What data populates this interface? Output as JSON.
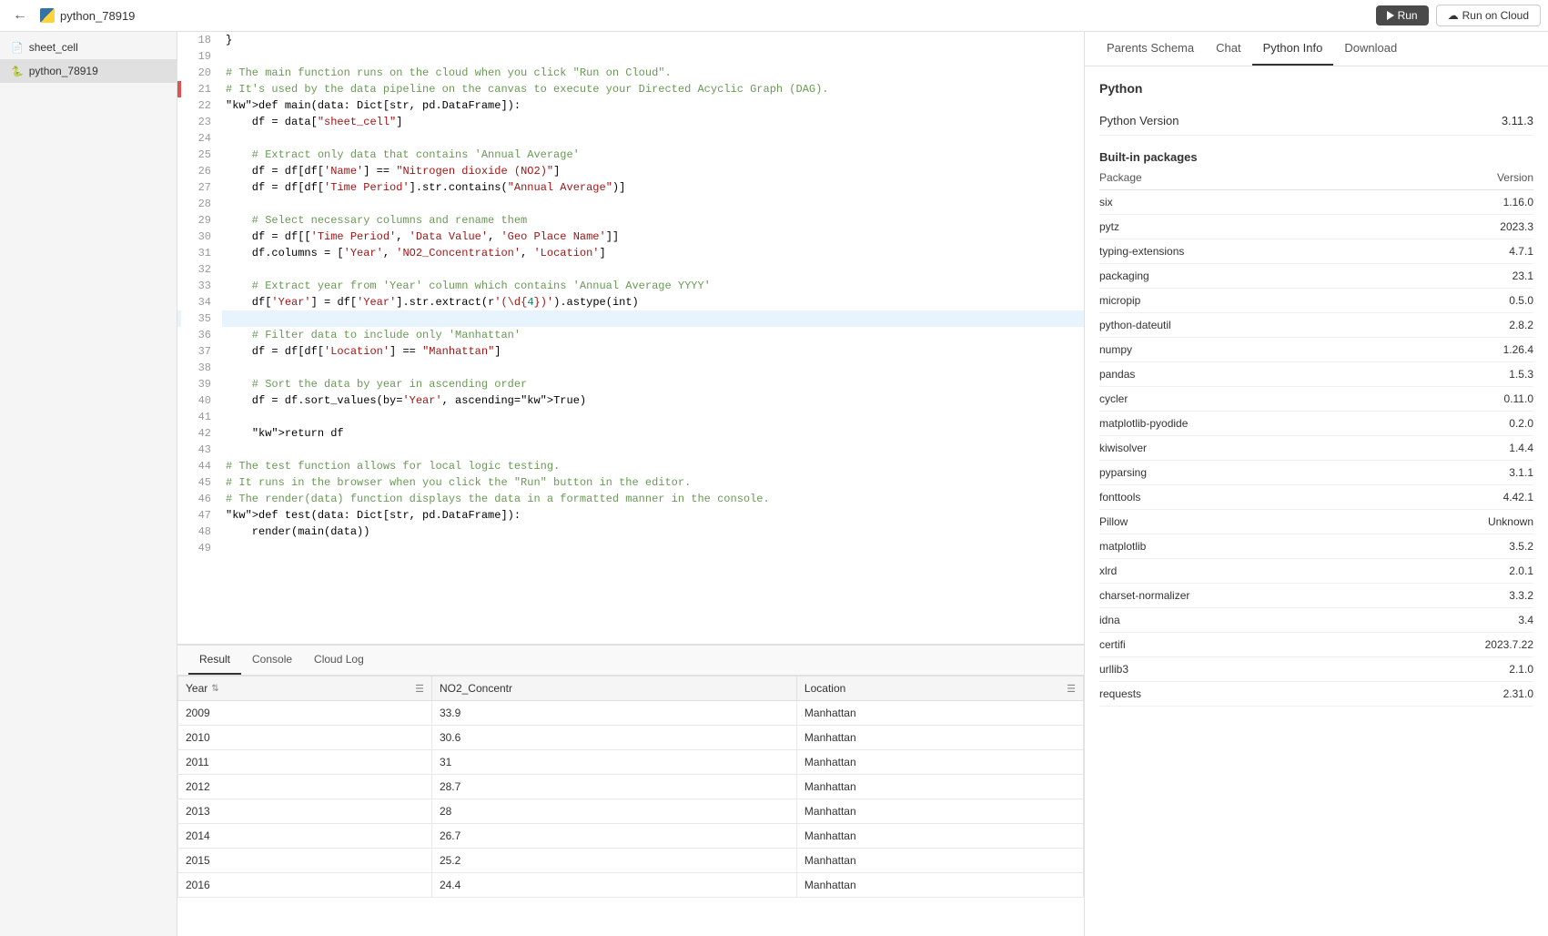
{
  "topbar": {
    "title": "python_78919",
    "run_label": "Run",
    "run_cloud_label": "Run on Cloud"
  },
  "sidebar": {
    "items": [
      {
        "id": "sheet_cell",
        "label": "sheet_cell",
        "icon": "📄"
      },
      {
        "id": "python_78919",
        "label": "python_78919",
        "icon": "🐍",
        "active": true
      }
    ]
  },
  "code": {
    "lines": [
      {
        "num": 18,
        "content": "}",
        "marker": "none"
      },
      {
        "num": 19,
        "content": "",
        "marker": "none"
      },
      {
        "num": 20,
        "content": "# The main function runs on the cloud when you click \"Run on Cloud\".",
        "type": "comment",
        "marker": "none"
      },
      {
        "num": 21,
        "content": "# It's used by the data pipeline on the canvas to execute your Directed Acyclic Graph (DAG).",
        "type": "comment",
        "marker": "error"
      },
      {
        "num": 22,
        "content": "def main(data: Dict[str, pd.DataFrame]):",
        "type": "code",
        "marker": "none"
      },
      {
        "num": 23,
        "content": "    df = data[\"sheet_cell\"]",
        "type": "code",
        "marker": "none"
      },
      {
        "num": 24,
        "content": "",
        "marker": "none"
      },
      {
        "num": 25,
        "content": "    # Extract only data that contains 'Annual Average'",
        "type": "comment",
        "marker": "none"
      },
      {
        "num": 26,
        "content": "    df = df[df['Name'] == \"Nitrogen dioxide (NO2)\"]",
        "type": "code",
        "marker": "none"
      },
      {
        "num": 27,
        "content": "    df = df[df['Time Period'].str.contains(\"Annual Average\")]",
        "type": "code",
        "marker": "none"
      },
      {
        "num": 28,
        "content": "",
        "marker": "none"
      },
      {
        "num": 29,
        "content": "    # Select necessary columns and rename them",
        "type": "comment",
        "marker": "none"
      },
      {
        "num": 30,
        "content": "    df = df[['Time Period', 'Data Value', 'Geo Place Name']]",
        "type": "code",
        "marker": "none"
      },
      {
        "num": 31,
        "content": "    df.columns = ['Year', 'NO2_Concentration', 'Location']",
        "type": "code",
        "marker": "none"
      },
      {
        "num": 32,
        "content": "",
        "marker": "none"
      },
      {
        "num": 33,
        "content": "    # Extract year from 'Year' column which contains 'Annual Average YYYY'",
        "type": "comment",
        "marker": "none"
      },
      {
        "num": 34,
        "content": "    df['Year'] = df['Year'].str.extract(r'(\\d{4})').astype(int)",
        "type": "code",
        "marker": "none"
      },
      {
        "num": 35,
        "content": "",
        "marker": "highlight"
      },
      {
        "num": 36,
        "content": "    # Filter data to include only 'Manhattan'",
        "type": "comment",
        "marker": "none"
      },
      {
        "num": 37,
        "content": "    df = df[df['Location'] == \"Manhattan\"]",
        "type": "code",
        "marker": "none"
      },
      {
        "num": 38,
        "content": "",
        "marker": "none"
      },
      {
        "num": 39,
        "content": "    # Sort the data by year in ascending order",
        "type": "comment",
        "marker": "none"
      },
      {
        "num": 40,
        "content": "    df = df.sort_values(by='Year', ascending=True)",
        "type": "code",
        "marker": "none"
      },
      {
        "num": 41,
        "content": "",
        "marker": "none"
      },
      {
        "num": 42,
        "content": "    return df",
        "type": "code",
        "marker": "none"
      },
      {
        "num": 43,
        "content": "",
        "marker": "none"
      },
      {
        "num": 44,
        "content": "# The test function allows for local logic testing.",
        "type": "comment",
        "marker": "none"
      },
      {
        "num": 45,
        "content": "# It runs in the browser when you click the \"Run\" button in the editor.",
        "type": "comment",
        "marker": "none"
      },
      {
        "num": 46,
        "content": "# The render(data) function displays the data in a formatted manner in the console.",
        "type": "comment",
        "marker": "none"
      },
      {
        "num": 47,
        "content": "def test(data: Dict[str, pd.DataFrame]):",
        "type": "code",
        "marker": "none"
      },
      {
        "num": 48,
        "content": "    render(main(data))",
        "type": "code",
        "marker": "none"
      },
      {
        "num": 49,
        "content": "",
        "marker": "none"
      }
    ]
  },
  "bottom_panel": {
    "tabs": [
      "Result",
      "Console",
      "Cloud Log"
    ],
    "active_tab": "Result",
    "table": {
      "columns": [
        "Year",
        "NO2_Concentr",
        "Location"
      ],
      "rows": [
        [
          "2009",
          "33.9",
          "Manhattan"
        ],
        [
          "2010",
          "30.6",
          "Manhattan"
        ],
        [
          "2011",
          "31",
          "Manhattan"
        ],
        [
          "2012",
          "28.7",
          "Manhattan"
        ],
        [
          "2013",
          "28",
          "Manhattan"
        ],
        [
          "2014",
          "26.7",
          "Manhattan"
        ],
        [
          "2015",
          "25.2",
          "Manhattan"
        ],
        [
          "2016",
          "24.4",
          "Manhattan"
        ]
      ]
    }
  },
  "right_panel": {
    "tabs": [
      "Parents Schema",
      "Chat",
      "Python Info",
      "Download"
    ],
    "active_tab": "Python Info",
    "python_info": {
      "section_title": "Python",
      "version_label": "Python Version",
      "version_value": "3.11.3",
      "built_in_title": "Built-in packages",
      "packages_col1": "Package",
      "packages_col2": "Version",
      "packages": [
        {
          "name": "six",
          "version": "1.16.0"
        },
        {
          "name": "pytz",
          "version": "2023.3"
        },
        {
          "name": "typing-extensions",
          "version": "4.7.1"
        },
        {
          "name": "packaging",
          "version": "23.1"
        },
        {
          "name": "micropip",
          "version": "0.5.0"
        },
        {
          "name": "python-dateutil",
          "version": "2.8.2"
        },
        {
          "name": "numpy",
          "version": "1.26.4"
        },
        {
          "name": "pandas",
          "version": "1.5.3"
        },
        {
          "name": "cycler",
          "version": "0.11.0"
        },
        {
          "name": "matplotlib-pyodide",
          "version": "0.2.0"
        },
        {
          "name": "kiwisolver",
          "version": "1.4.4"
        },
        {
          "name": "pyparsing",
          "version": "3.1.1"
        },
        {
          "name": "fonttools",
          "version": "4.42.1"
        },
        {
          "name": "Pillow",
          "version": "Unknown"
        },
        {
          "name": "matplotlib",
          "version": "3.5.2"
        },
        {
          "name": "xlrd",
          "version": "2.0.1"
        },
        {
          "name": "charset-normalizer",
          "version": "3.3.2"
        },
        {
          "name": "idna",
          "version": "3.4"
        },
        {
          "name": "certifi",
          "version": "2023.7.22"
        },
        {
          "name": "urllib3",
          "version": "2.1.0"
        },
        {
          "name": "requests",
          "version": "2.31.0"
        }
      ]
    }
  }
}
